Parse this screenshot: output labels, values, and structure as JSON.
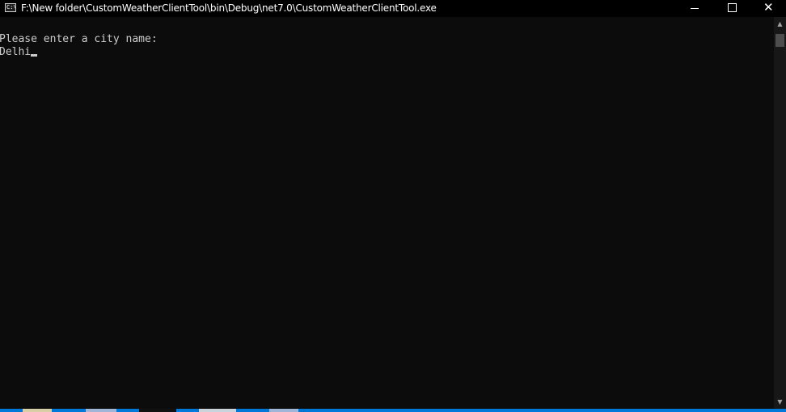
{
  "window": {
    "title": "F:\\New folder\\CustomWeatherClientTool\\bin\\Debug\\net7.0\\CustomWeatherClientTool.exe",
    "app_icon_text": "C:\\",
    "app_icon": "console-app-icon",
    "controls": {
      "minimize_icon": "minimize-icon",
      "maximize_icon": "maximize-icon",
      "close_icon": "close-icon",
      "close_glyph": "✕"
    }
  },
  "console": {
    "prompt": "Please enter a city name:",
    "input": "Delhi",
    "text_color": "#cccccc",
    "background": "#0c0c0c"
  },
  "scrollbar": {
    "up_arrow": "▲",
    "down_arrow": "▼"
  },
  "taskbar": {
    "accent": "#0078d7"
  }
}
